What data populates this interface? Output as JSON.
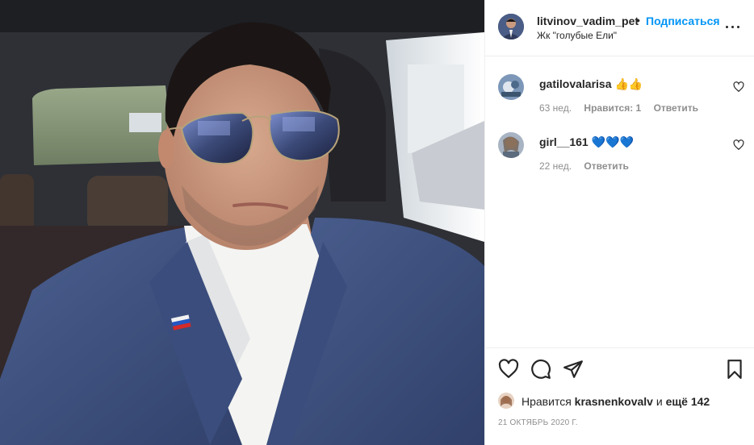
{
  "post": {
    "username": "litvinov_vadim_pet",
    "separator": "•",
    "follow_label": "Подписаться",
    "location": "Жк \"голубые Ели\"",
    "more_icon": "more-horizontal-icon"
  },
  "comments": [
    {
      "username": "gatilovalarisa",
      "text": "👍👍",
      "age": "63 нед.",
      "likes": "Нравится: 1",
      "reply": "Ответить"
    },
    {
      "username": "girl__161",
      "text": "💙💙💙",
      "age": "22 нед.",
      "reply": "Ответить"
    }
  ],
  "actions": {
    "like_icon": "heart-icon",
    "comment_icon": "comment-icon",
    "share_icon": "send-icon",
    "save_icon": "bookmark-icon"
  },
  "likes": {
    "prefix": "Нравится",
    "user": "krasnenkovalv",
    "conj": "и",
    "others": "ещё 142"
  },
  "date": "21 ОКТЯБРЬ 2020 Г.",
  "colors": {
    "accent": "#0095f6",
    "text": "#262626",
    "muted": "#8e8e8e",
    "divider": "#efefef",
    "heart_blue": "#1f6fd6"
  }
}
